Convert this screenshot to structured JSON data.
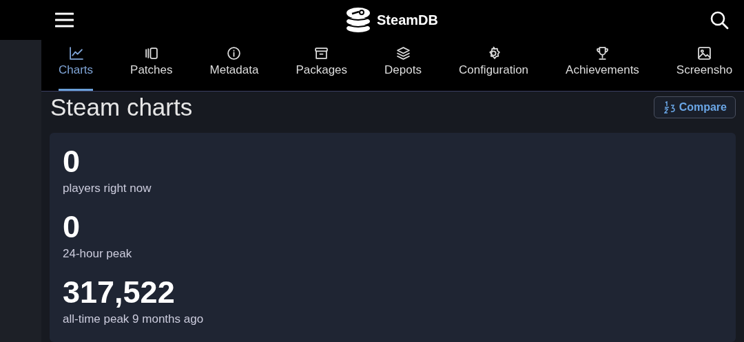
{
  "header": {
    "logo_text": "SteamDB"
  },
  "tabs": [
    {
      "label": "Charts",
      "selected": true
    },
    {
      "label": "Patches",
      "selected": false
    },
    {
      "label": "Metadata",
      "selected": false
    },
    {
      "label": "Packages",
      "selected": false
    },
    {
      "label": "Depots",
      "selected": false
    },
    {
      "label": "Configuration",
      "selected": false
    },
    {
      "label": "Achievements",
      "selected": false
    },
    {
      "label": "Screensho",
      "selected": false
    }
  ],
  "page_title": "Steam charts",
  "compare_button": {
    "label": "Compare"
  },
  "stats": [
    {
      "value": "0",
      "label": "players right now"
    },
    {
      "value": "0",
      "label": "24-hour peak"
    },
    {
      "value": "317,522",
      "label": "all-time peak 9 months ago"
    }
  ]
}
